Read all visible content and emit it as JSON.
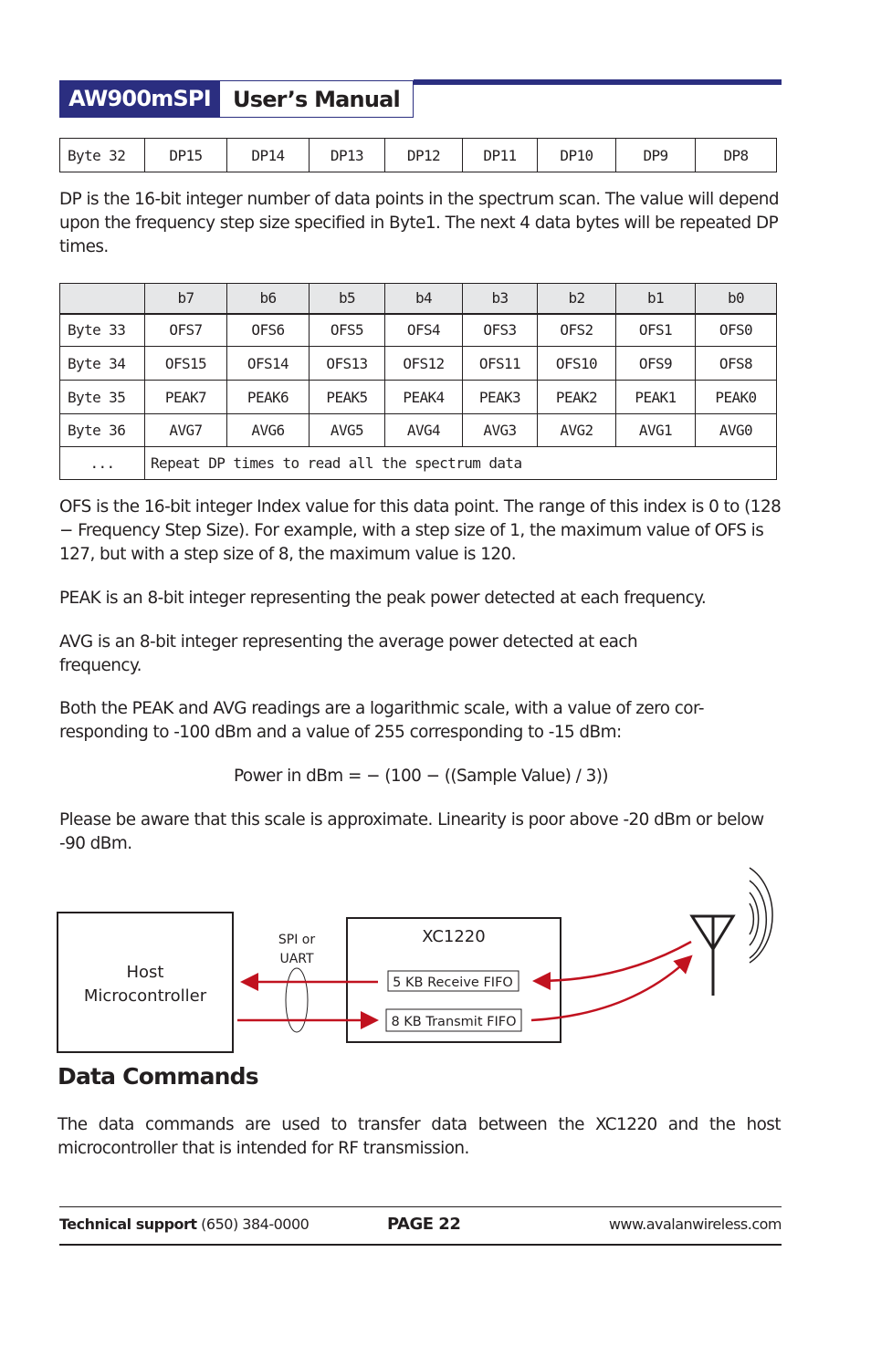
{
  "header": {
    "product": "AW900mSPI",
    "title": "User’s Manual",
    "accent_color": "#2b2e80"
  },
  "table1": {
    "row": [
      "Byte 32",
      "DP15",
      "DP14",
      "DP13",
      "DP12",
      "DP11",
      "DP10",
      "DP9",
      "DP8"
    ]
  },
  "para_dp": "DP is the 16-bit integer number of data points in the spectrum scan. The value will depend upon the frequency step size specified in Byte1. The next 4 data bytes will be repeated DP times.",
  "table2": {
    "headers": [
      "",
      "b7",
      "b6",
      "b5",
      "b4",
      "b3",
      "b2",
      "b1",
      "b0"
    ],
    "rows": [
      [
        "Byte 33",
        "OFS7",
        "OFS6",
        "OFS5",
        "OFS4",
        "OFS3",
        "OFS2",
        "OFS1",
        "OFS0"
      ],
      [
        "Byte 34",
        "OFS15",
        "OFS14",
        "OFS13",
        "OFS12",
        "OFS11",
        "OFS10",
        "OFS9",
        "OFS8"
      ],
      [
        "Byte 35",
        "PEAK7",
        "PEAK6",
        "PEAK5",
        "PEAK4",
        "PEAK3",
        "PEAK2",
        "PEAK1",
        "PEAK0"
      ],
      [
        "Byte 36",
        "AVG7",
        "AVG6",
        "AVG5",
        "AVG4",
        "AVG3",
        "AVG2",
        "AVG1",
        "AVG0"
      ]
    ],
    "repeat_row": {
      "label": "...",
      "text": "Repeat DP times to read all the spectrum data"
    }
  },
  "para_ofs": "OFS is the 16-bit integer Index value for this data point. The range of this index is 0 to (128 − Frequency Step Size). For example, with a step size of 1, the maximum value of OFS is 127, but with a step size of 8, the maximum value is 120.",
  "para_peak": "PEAK is an 8-bit integer representing the peak power detected at each frequency.",
  "para_avg": "AVG is an 8-bit integer representing the average power detected at each frequency.",
  "para_log": "Both the PEAK and AVG readings are a logarithmic scale, with a value of zero cor-responding to -100 dBm and a value of 255 corresponding to -15 dBm:",
  "formula": "Power in dBm = − (100 − ((Sample Value) / 3))",
  "para_approx": "Please be aware that this scale is approximate. Linearity is poor above -20 dBm or below -90 dBm.",
  "diagram": {
    "host_line1": "Host",
    "host_line2": "Microcontroller",
    "bus_line1": "SPI or",
    "bus_line2": "UART",
    "chip": "XC1220",
    "rx_fifo": "5 KB Receive FIFO",
    "tx_fifo": "8 KB Transmit FIFO",
    "arrow_color": "#c1121f"
  },
  "section": {
    "title": "Data Commands",
    "body": "The data commands are used to transfer data between the XC1220 and the host microcontroller that is intended for RF transmission."
  },
  "footer": {
    "support_label": "Technical support",
    "support_phone": "(650) 384-0000",
    "page": "PAGE 22",
    "website": "www.avalanwireless.com"
  }
}
